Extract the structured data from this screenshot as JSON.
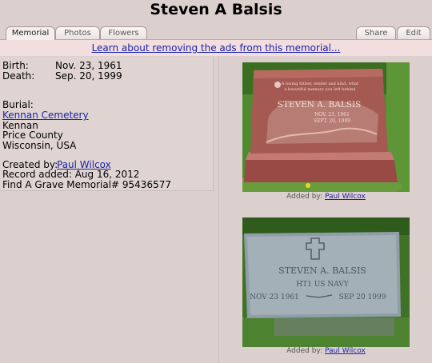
{
  "page": {
    "title": "Steven A Balsis"
  },
  "tabs": {
    "memorial": "Memorial",
    "photos": "Photos",
    "flowers": "Flowers",
    "share": "Share",
    "edit": "Edit"
  },
  "ads": {
    "link_text": "Learn about removing the ads from this memorial..."
  },
  "details": {
    "birth_label": "Birth:",
    "birth_value": "Nov. 23, 1961",
    "death_label": "Death:",
    "death_value": "Sep. 20, 1999",
    "burial_label": "Burial:",
    "cemetery": "Kennan Cemetery",
    "town": "Kennan",
    "county": "Price County",
    "state": "Wisconsin, USA",
    "created_label": "Created by:",
    "creator": "Paul Wilcox",
    "record_added": "Record added: Aug 16, 2012",
    "memorial_id": "Find A Grave Memorial# 95436577"
  },
  "photos": [
    {
      "added_by_label": "Added by:",
      "added_by": "Paul Wilcox",
      "engraving": {
        "verse_1": "A loving father, tender and kind, what",
        "verse_2": "a beautiful memory you left behind",
        "name": "STEVEN A. BALSIS",
        "born": "NOV. 23, 1961",
        "died": "SEPT. 20, 1999"
      }
    },
    {
      "added_by_label": "Added by:",
      "added_by": "Paul Wilcox",
      "engraving": {
        "name": "STEVEN A. BALSIS",
        "rank": "HT1 US NAVY",
        "born": "NOV 23 1961",
        "died": "SEP 20 1999"
      }
    }
  ],
  "colors": {
    "background": "#dcd0ce",
    "ads_bar": "#f2dede",
    "link": "#1a23a8",
    "granite_red": "#a45a52",
    "granite_grey": "#8f9ea8",
    "grass": "#4f8a2f"
  }
}
